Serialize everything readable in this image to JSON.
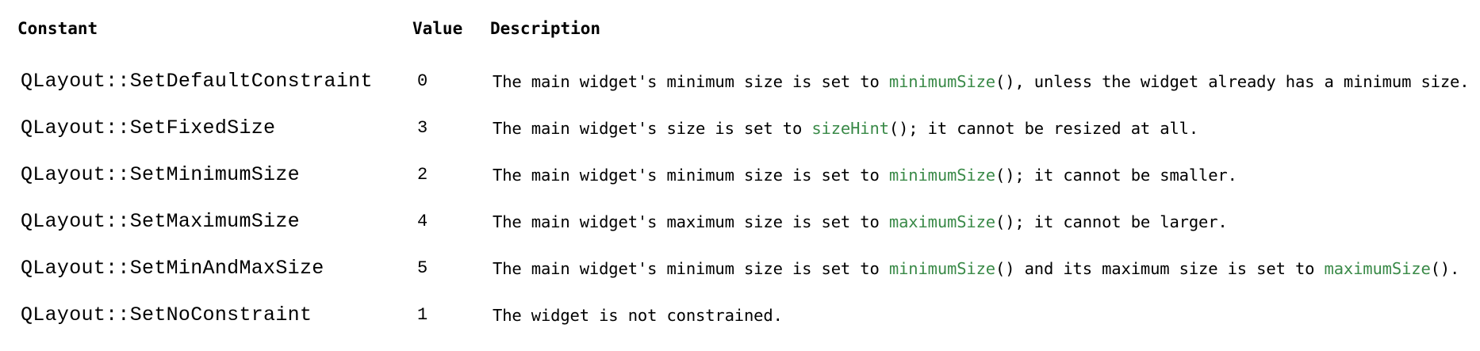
{
  "table": {
    "headers": {
      "constant": "Constant",
      "value": "Value",
      "description": "Description"
    },
    "rows": [
      {
        "constant": "QLayout::SetDefaultConstraint",
        "value": "0",
        "desc": {
          "t1": "The main widget's minimum size is set to ",
          "link1": "minimumSize",
          "t2": "(), unless the widget already has a minimum size.",
          "link2": "",
          "t3": ""
        }
      },
      {
        "constant": "QLayout::SetFixedSize",
        "value": "3",
        "desc": {
          "t1": "The main widget's size is set to ",
          "link1": "sizeHint",
          "t2": "(); it cannot be resized at all.",
          "link2": "",
          "t3": ""
        }
      },
      {
        "constant": "QLayout::SetMinimumSize",
        "value": "2",
        "desc": {
          "t1": "The main widget's minimum size is set to ",
          "link1": "minimumSize",
          "t2": "(); it cannot be smaller.",
          "link2": "",
          "t3": ""
        }
      },
      {
        "constant": "QLayout::SetMaximumSize",
        "value": "4",
        "desc": {
          "t1": "The main widget's maximum size is set to ",
          "link1": "maximumSize",
          "t2": "(); it cannot be larger.",
          "link2": "",
          "t3": ""
        }
      },
      {
        "constant": "QLayout::SetMinAndMaxSize",
        "value": "5",
        "desc": {
          "t1": "The main widget's minimum size is set to ",
          "link1": "minimumSize",
          "t2": "() and its maximum size is set to ",
          "link2": "maximumSize",
          "t3": "()."
        }
      },
      {
        "constant": "QLayout::SetNoConstraint",
        "value": "1",
        "desc": {
          "t1": "The widget is not constrained.",
          "link1": "",
          "t2": "",
          "link2": "",
          "t3": ""
        }
      }
    ]
  },
  "colors": {
    "link": "#3a8a48",
    "text": "#000000",
    "background": "#ffffff"
  }
}
